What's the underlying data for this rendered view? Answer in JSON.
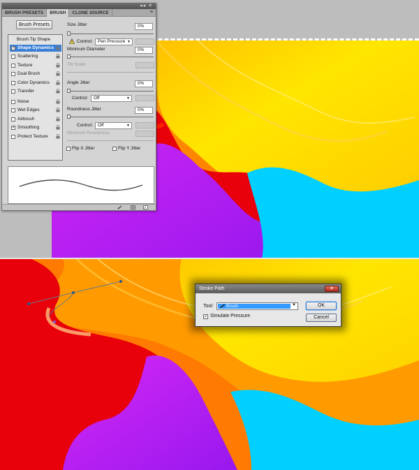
{
  "panel": {
    "tabs": [
      "BRUSH PRESETS",
      "BRUSH",
      "CLONE SOURCE"
    ],
    "window_controls": "◂◂ ✕",
    "menu_icon": "≡",
    "brush_presets_button": "Brush Presets",
    "list_header": "Brush Tip Shape",
    "items": [
      {
        "label": "Shape Dynamics",
        "checked": true,
        "active": true
      },
      {
        "label": "Scattering",
        "checked": false
      },
      {
        "label": "Texture",
        "checked": false
      },
      {
        "label": "Dual Brush",
        "checked": false
      },
      {
        "label": "Color Dynamics",
        "checked": false
      },
      {
        "label": "Transfer",
        "checked": false
      },
      {
        "label": "Noise",
        "checked": false
      },
      {
        "label": "Wet Edges",
        "checked": false
      },
      {
        "label": "Airbrush",
        "checked": false
      },
      {
        "label": "Smoothing",
        "checked": true
      },
      {
        "label": "Protect Texture",
        "checked": false
      }
    ],
    "size_jitter_label": "Size Jitter",
    "size_jitter_value": "0%",
    "control1_label": "Control:",
    "control1_value": "Pen Pressure",
    "min_diameter_label": "Minimum Diameter",
    "min_diameter_value": "0%",
    "tilt_scale_label": "Tilt Scale",
    "angle_jitter_label": "Angle Jitter",
    "angle_jitter_value": "0%",
    "control2_label": "Control:",
    "control2_value": "Off",
    "roundness_jitter_label": "Roundness Jitter",
    "roundness_jitter_value": "0%",
    "control3_label": "Control:",
    "control3_value": "Off",
    "min_roundness_label": "Minimum Roundness",
    "flip_x_label": "Flip X Jitter",
    "flip_y_label": "Flip Y Jitter",
    "check_mark": "✓"
  },
  "dialog": {
    "title": "Stroke Path",
    "close_symbol": "✕",
    "tool_label": "Tool:",
    "tool_value": "Brush",
    "simulate_pressure_label": "Simulate Pressure",
    "simulate_pressure_checked": "✓",
    "ok_label": "OK",
    "cancel_label": "Cancel",
    "dropdown_arrow": "▼"
  },
  "colors": {
    "red": "#e8000a",
    "purple": "#b21cf0",
    "cyan": "#00d0ff",
    "orange": "#ff7a00",
    "yellow": "#ffe600",
    "selection": "#3a7fd6"
  }
}
